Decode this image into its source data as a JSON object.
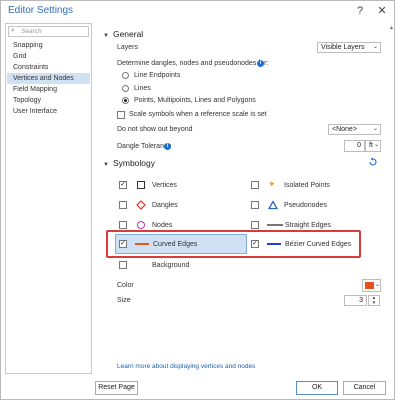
{
  "window": {
    "title": "Editor Settings"
  },
  "titlebar": {
    "help_glyph": "?",
    "close_glyph": "✕"
  },
  "search": {
    "placeholder": "Search"
  },
  "sidebar": {
    "items": [
      {
        "label": "Snapping",
        "selected": false
      },
      {
        "label": "Grid",
        "selected": false
      },
      {
        "label": "Constraints",
        "selected": false
      },
      {
        "label": "Vertices and Nodes",
        "selected": true
      },
      {
        "label": "Field Mapping",
        "selected": false
      },
      {
        "label": "Topology",
        "selected": false
      },
      {
        "label": "User Interface",
        "selected": false
      }
    ]
  },
  "general": {
    "heading": "General",
    "layers_label": "Layers",
    "layers_value": "Visible Layers",
    "determine_label": "Determine dangles, nodes and pseudonodes for:",
    "options": [
      "Line Endpoints",
      "Lines",
      "Points, Multipoints, Lines and Polygons"
    ],
    "selected_option": 2,
    "scale_label": "Scale symbols when a reference scale is set",
    "donot_label": "Do not show out beyond",
    "donot_value": "<None>",
    "dangle_label": "Dangle Tolerance",
    "dangle_value": "0",
    "dangle_unit": "ft"
  },
  "symbology": {
    "heading": "Symbology",
    "items": {
      "vertices": {
        "label": "Vertices",
        "checked": true
      },
      "isolated_points": {
        "label": "Isolated Points",
        "checked": false
      },
      "dangles": {
        "label": "Dangles",
        "checked": false
      },
      "pseudonodes": {
        "label": "Pseudonodes",
        "checked": false
      },
      "nodes": {
        "label": "Nodes",
        "checked": false
      },
      "straight_edges": {
        "label": "Straight Edges",
        "checked": false
      },
      "curved_edges": {
        "label": "Curved Edges",
        "checked": true
      },
      "bezier_curved_edges": {
        "label": "Bézier Curved Edges",
        "checked": true
      },
      "background": {
        "label": "Background",
        "checked": false
      }
    },
    "color_label": "Color",
    "color_value": "#e8501f",
    "size_label": "Size",
    "size_value": "3"
  },
  "colors": {
    "accent": "#1f6fd1",
    "selection": "#cfe1f3",
    "highlight": "#d93a3a",
    "curved_edge": "#e05a1e",
    "bezier_edge": "#1f3fd6",
    "dangle": "#e03020",
    "nodes": "#c9379c",
    "isolated": "#f0a020",
    "pseudonode": "#2b64c8"
  },
  "footer": {
    "link": "Learn more about displaying vertices and nodes",
    "reset": "Reset Page",
    "ok": "OK",
    "cancel": "Cancel"
  }
}
